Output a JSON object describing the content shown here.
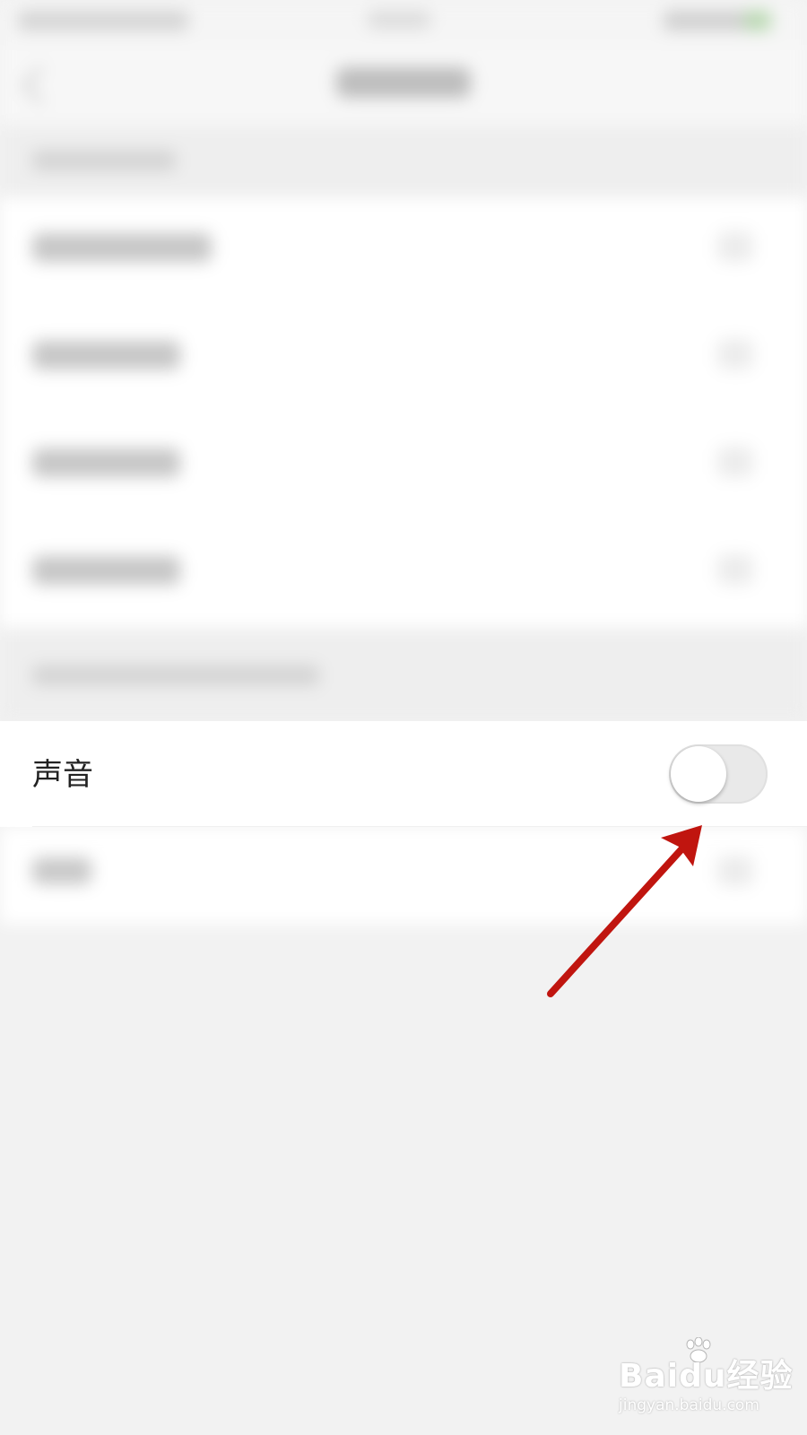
{
  "settings": {
    "sound_label": "声音",
    "sound_enabled": false
  },
  "colors": {
    "page_background": "#f2f2f2",
    "row_background": "#ffffff",
    "toggle_off_track": "#e9e9e9",
    "annotation_arrow": "#c0150f"
  },
  "watermark": {
    "logo_text": "Baidu经验",
    "url_text": "jingyan.baidu.com"
  }
}
